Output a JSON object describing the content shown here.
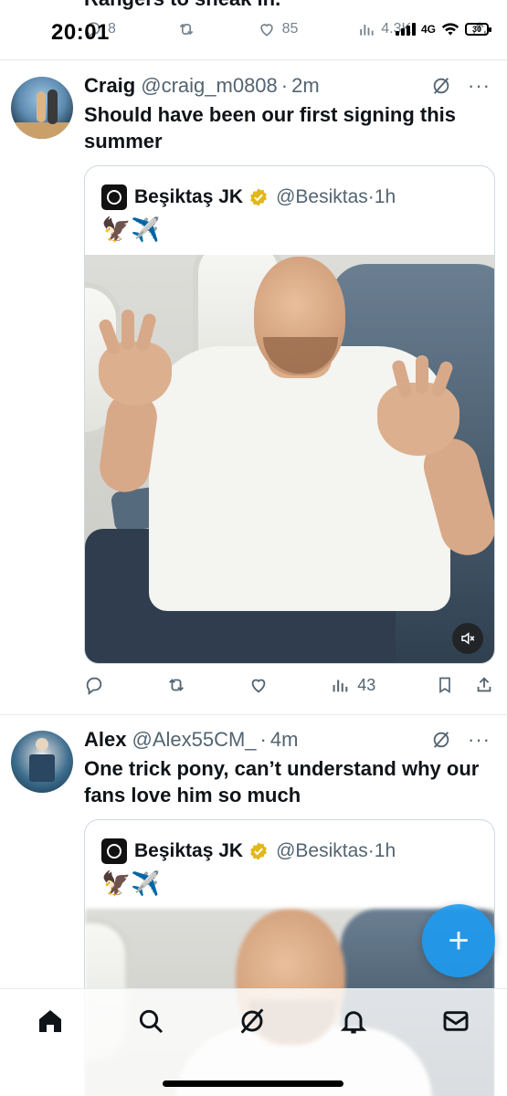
{
  "status_bar": {
    "time": "20:01",
    "network": "4G",
    "battery": "30"
  },
  "previous_tweet": {
    "partial_text": "Rangers to sneak in.",
    "actions": {
      "reply_count": "8",
      "like_count": "85",
      "views_count": "4.3K"
    }
  },
  "tweets": [
    {
      "name": "Craig",
      "handle": "@craig_m0808",
      "time": "2m",
      "text": "Should have been our first signing this summer",
      "quote": {
        "name": "Beşiktaş JK",
        "handle": "@Besiktas",
        "time": "1h",
        "emoji": "🦅✈️"
      },
      "actions": {
        "views_count": "43"
      }
    },
    {
      "name": "Alex",
      "handle": "@Alex55CM_",
      "time": "4m",
      "text": "One trick pony, can’t understand why our fans love him so much",
      "quote": {
        "name": "Beşiktaş JK",
        "handle": "@Besiktas",
        "time": "1h",
        "emoji": "🦅✈️"
      }
    }
  ],
  "fab": {
    "label": "+"
  },
  "colors": {
    "accent": "#1d9bf0",
    "text_primary": "#0f1419",
    "text_secondary": "#536471",
    "border": "#cfd9de",
    "verified_gold": "#e2b719"
  },
  "icons": {
    "bottom_nav": [
      "home-icon",
      "search-icon",
      "grok-icon",
      "notifications-icon",
      "messages-icon"
    ]
  }
}
